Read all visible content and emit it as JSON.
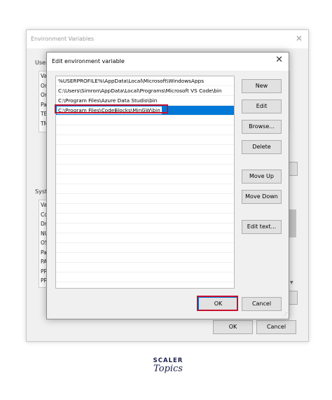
{
  "env_window": {
    "title": "Environment Variables",
    "user_section_label": "User",
    "user_rows": [
      "Va",
      "On",
      "On",
      "Pat",
      "TEI",
      "TM"
    ],
    "system_section_label": "Syste",
    "system_rows": [
      "Va",
      "Co",
      "Dri",
      "NU",
      "OS",
      "Pat",
      "PA",
      "PR",
      "PR"
    ],
    "ok_label": "OK",
    "cancel_label": "Cancel"
  },
  "edit_dialog": {
    "title": "Edit environment variable",
    "paths": [
      "%USERPROFILE%\\AppData\\Local\\Microsoft\\WindowsApps",
      "C:\\Users\\Simron\\AppData\\Local\\Programs\\Microsoft VS Code\\bin",
      "C:\\Program Files\\Azure Data Studio\\bin",
      "C:\\Program Files\\CodeBlocks\\MinGW\\bin"
    ],
    "selected_index": 3,
    "buttons": {
      "new": "New",
      "edit": "Edit",
      "browse": "Browse...",
      "delete": "Delete",
      "move_up": "Move Up",
      "move_down": "Move Down",
      "edit_text": "Edit text..."
    },
    "ok_label": "OK",
    "cancel_label": "Cancel"
  },
  "logo": {
    "top": "SCALER",
    "bottom": "Topics"
  },
  "colors": {
    "selection": "#0078d7",
    "highlight": "#c8102e",
    "dialog_bg": "#f0f0f0"
  }
}
